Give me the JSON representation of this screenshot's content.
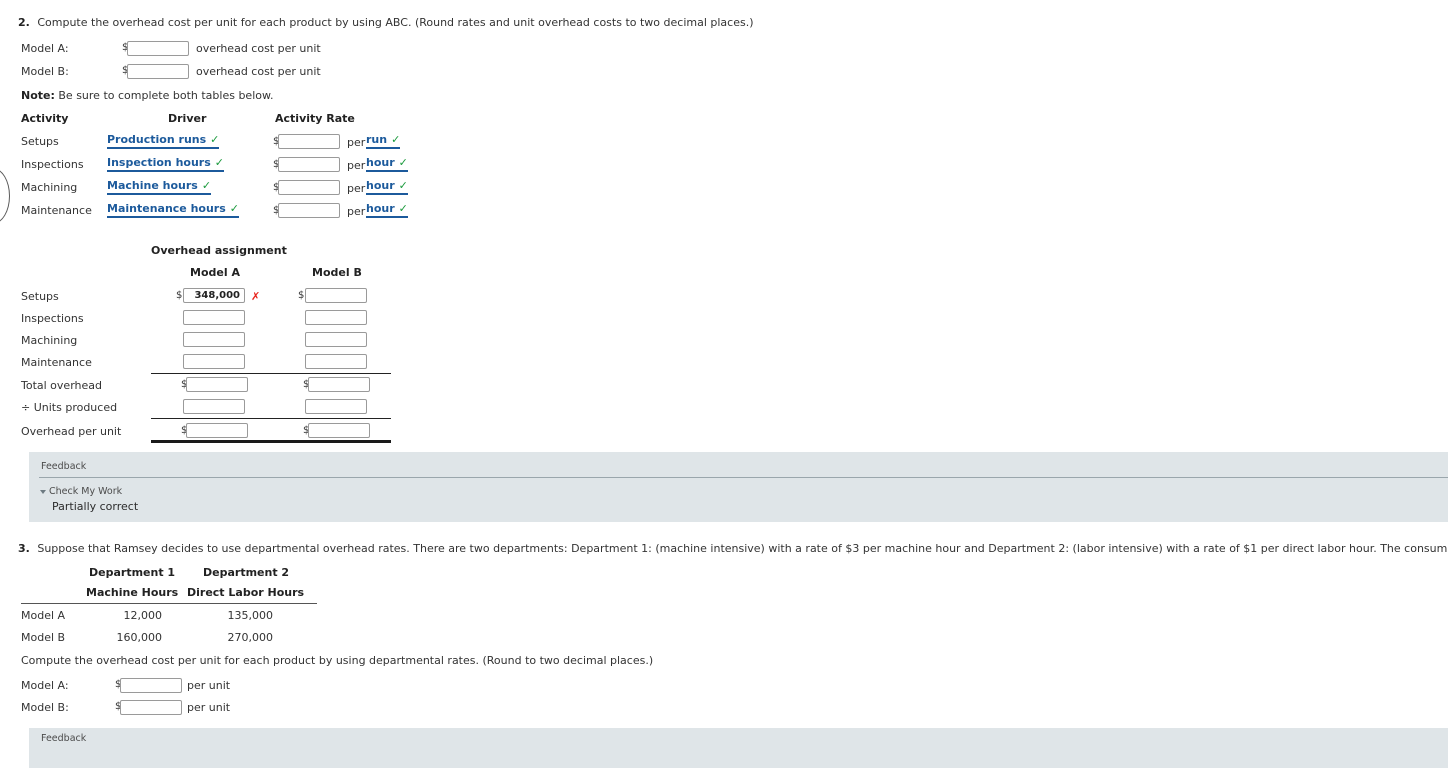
{
  "q2": {
    "number": "2.",
    "prompt": "Compute the overhead cost per unit for each product by using ABC. (Round rates and unit overhead costs to two decimal places.)",
    "answers": [
      {
        "label": "Model A:",
        "dollar": "$",
        "value": "",
        "suffix": "overhead cost per unit"
      },
      {
        "label": "Model B:",
        "dollar": "$",
        "value": "",
        "suffix": "overhead cost per unit"
      }
    ],
    "note_bold": "Note:",
    "note_rest": " Be sure to complete both tables below."
  },
  "activity_table": {
    "headers": {
      "activity": "Activity",
      "driver": "Driver",
      "rate": "Activity Rate"
    },
    "rows": [
      {
        "activity": "Setups",
        "driver": "Production runs",
        "driver_status": "check",
        "dollar": "$",
        "rate_value": "",
        "per": "per",
        "unit": "run",
        "unit_status": "check"
      },
      {
        "activity": "Inspections",
        "driver": "Inspection hours",
        "driver_status": "check",
        "dollar": "$",
        "rate_value": "",
        "per": "per",
        "unit": "hour",
        "unit_status": "check"
      },
      {
        "activity": "Machining",
        "driver": "Machine hours",
        "driver_status": "check",
        "dollar": "$",
        "rate_value": "",
        "per": "per",
        "unit": "hour",
        "unit_status": "check"
      },
      {
        "activity": "Maintenance",
        "driver": "Maintenance hours",
        "driver_status": "check",
        "dollar": "$",
        "rate_value": "",
        "per": "per",
        "unit": "hour",
        "unit_status": "check"
      }
    ]
  },
  "overhead_assignment": {
    "title": "Overhead assignment",
    "col_a": "Model A",
    "col_b": "Model B",
    "rows": [
      {
        "label": "Setups",
        "a_dollar": "$",
        "a_value": "348,000",
        "a_status": "x",
        "b_dollar": "$",
        "b_value": "",
        "b_status": ""
      },
      {
        "label": "Inspections",
        "a_dollar": "",
        "a_value": "",
        "a_status": "",
        "b_dollar": "",
        "b_value": "",
        "b_status": ""
      },
      {
        "label": "Machining",
        "a_dollar": "",
        "a_value": "",
        "a_status": "",
        "b_dollar": "",
        "b_value": "",
        "b_status": ""
      },
      {
        "label": "Maintenance",
        "a_dollar": "",
        "a_value": "",
        "a_status": "",
        "b_dollar": "",
        "b_value": "",
        "b_status": ""
      },
      {
        "label": "Total overhead",
        "a_dollar": "$",
        "a_value": "",
        "a_status": "",
        "b_dollar": "$",
        "b_value": "",
        "b_status": ""
      },
      {
        "label": "÷ Units produced",
        "a_dollar": "",
        "a_value": "",
        "a_status": "",
        "b_dollar": "",
        "b_value": "",
        "b_status": ""
      },
      {
        "label": "Overhead per unit",
        "a_dollar": "$",
        "a_value": "",
        "a_status": "",
        "b_dollar": "$",
        "b_value": "",
        "b_status": ""
      }
    ]
  },
  "feedback_1": {
    "title": "Feedback",
    "check_my_work": "Check My Work",
    "status": "Partially correct"
  },
  "q3": {
    "number": "3.",
    "prompt": "Suppose that Ramsey decides to use departmental overhead rates. There are two departments: Department 1: (machine intensive) with a rate of $3 per machine hour and Department 2: (labor intensive) with a rate of $1 per direct labor hour. The consumption of these two drivers is as follows:",
    "dept_table": {
      "head1_line1": "Department 1",
      "head1_line2": "Machine Hours",
      "head2_line1": "Department 2",
      "head2_line2": "Direct Labor Hours",
      "rows": [
        {
          "label": "Model A",
          "dept1": "12,000",
          "dept2": "135,000"
        },
        {
          "label": "Model B",
          "dept1": "160,000",
          "dept2": "270,000"
        }
      ]
    },
    "compute_prompt": "Compute the overhead cost per unit for each product by using departmental rates. (Round to two decimal places.)",
    "answers": [
      {
        "label": "Model A:",
        "dollar": "$",
        "value": "",
        "suffix": "per unit"
      },
      {
        "label": "Model B:",
        "dollar": "$",
        "value": "",
        "suffix": "per unit"
      }
    ]
  },
  "feedback_2": {
    "title": "Feedback"
  },
  "colors": {
    "link_blue": "#1c5a9c",
    "check_green": "#1a9a3c",
    "x_red": "#e8241c",
    "feedback_bg": "#dfe5e8"
  }
}
